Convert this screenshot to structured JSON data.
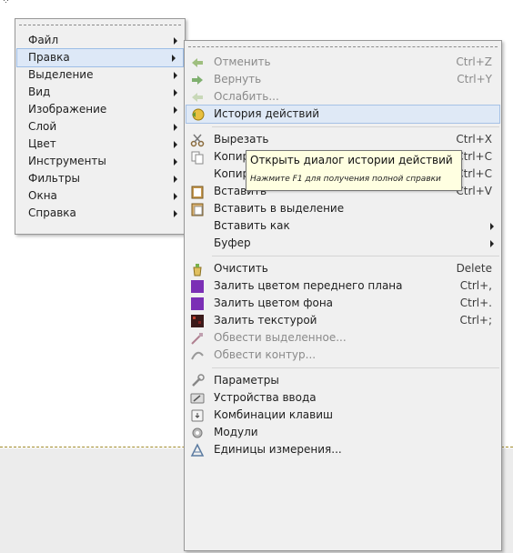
{
  "colors": {
    "menu_bg": "#f0f0f0",
    "highlight": "#dde8f7",
    "tooltip_bg": "#ffffe1",
    "fill_fg": "#7b2fb5",
    "fill_bg": "#7b2fb5"
  },
  "main_menu": {
    "items": [
      {
        "label": "Файл",
        "submenu": true
      },
      {
        "label": "Правка",
        "submenu": true,
        "active": true
      },
      {
        "label": "Выделение",
        "submenu": true
      },
      {
        "label": "Вид",
        "submenu": true
      },
      {
        "label": "Изображение",
        "submenu": true
      },
      {
        "label": "Слой",
        "submenu": true
      },
      {
        "label": "Цвет",
        "submenu": true
      },
      {
        "label": "Инструменты",
        "submenu": true
      },
      {
        "label": "Фильтры",
        "submenu": true
      },
      {
        "label": "Окна",
        "submenu": true
      },
      {
        "label": "Справка",
        "submenu": true
      }
    ]
  },
  "edit_menu": {
    "undo": {
      "label": "Отменить",
      "shortcut": "Ctrl+Z",
      "icon": "undo-icon",
      "disabled": true
    },
    "redo": {
      "label": "Вернуть",
      "shortcut": "Ctrl+Y",
      "icon": "redo-icon",
      "disabled": true
    },
    "fade": {
      "label": "Ослабить...",
      "icon": "fade-icon",
      "disabled": true
    },
    "history": {
      "label": "История действий",
      "icon": "history-icon",
      "highlighted": true
    },
    "cut": {
      "label": "Вырезать",
      "shortcut": "Ctrl+X",
      "icon": "scissors-icon"
    },
    "copy": {
      "label": "Копировать",
      "shortcut": "Ctrl+C",
      "icon": "copy-icon"
    },
    "copy_visible": {
      "label": "Копировать видимое",
      "shortcut": "Shift+Ctrl+C"
    },
    "paste": {
      "label": "Вставить",
      "shortcut": "Ctrl+V",
      "icon": "paste-icon"
    },
    "paste_into": {
      "label": "Вставить в выделение",
      "icon": "paste-into-icon"
    },
    "paste_as": {
      "label": "Вставить как",
      "submenu": true
    },
    "buffer": {
      "label": "Буфер",
      "submenu": true
    },
    "clear": {
      "label": "Очистить",
      "shortcut": "Delete",
      "icon": "clear-icon"
    },
    "fill_fg": {
      "label": "Залить цветом переднего плана",
      "shortcut": "Ctrl+,",
      "icon": "fill-fg-icon"
    },
    "fill_bg": {
      "label": "Залить цветом фона",
      "shortcut": "Ctrl+.",
      "icon": "fill-bg-icon"
    },
    "fill_pattern": {
      "label": "Залить текстурой",
      "shortcut": "Ctrl+;",
      "icon": "pattern-icon"
    },
    "stroke_selection": {
      "label": "Обвести выделенное...",
      "icon": "stroke-selection-icon",
      "disabled": true
    },
    "stroke_path": {
      "label": "Обвести контур...",
      "icon": "stroke-path-icon",
      "disabled": true
    },
    "preferences": {
      "label": "Параметры",
      "icon": "preferences-icon"
    },
    "input_devices": {
      "label": "Устройства ввода",
      "icon": "input-devices-icon"
    },
    "shortcuts": {
      "label": "Комбинации клавиш",
      "icon": "keyboard-icon"
    },
    "modules": {
      "label": "Модули",
      "icon": "modules-icon"
    },
    "units": {
      "label": "Единицы измерения...",
      "icon": "units-icon"
    }
  },
  "tooltip": {
    "title": "Открыть диалог истории действий",
    "hint": "Нажмите F1 для получения полной справки"
  }
}
